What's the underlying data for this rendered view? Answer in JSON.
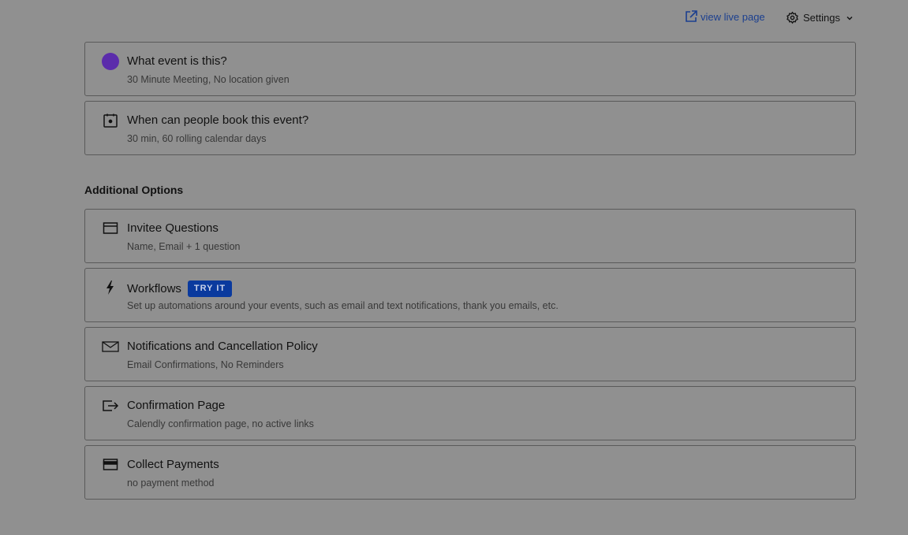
{
  "header": {
    "live_link_label": "view live page",
    "settings_label": "Settings"
  },
  "event_cards": [
    {
      "title": "What event is this?",
      "subtitle": "30 Minute Meeting, No location given",
      "icon": "purple-dot-icon"
    },
    {
      "title": "When can people book this event?",
      "subtitle": "30 min, 60 rolling calendar days",
      "icon": "calendar-icon"
    }
  ],
  "additional_options": {
    "heading": "Additional Options",
    "items": [
      {
        "title": "Invitee Questions",
        "subtitle": "Name, Email + 1 question",
        "icon": "form-icon"
      },
      {
        "title": "Workflows",
        "badge": "TRY IT",
        "subtitle": "Set up automations around your events, such as email and text notifications, thank you emails, etc.",
        "icon": "lightning-icon"
      },
      {
        "title": "Notifications and Cancellation Policy",
        "subtitle": "Email Confirmations, No Reminders",
        "icon": "envelope-icon"
      },
      {
        "title": "Confirmation Page",
        "subtitle": "Calendly confirmation page, no active links",
        "icon": "redirect-icon"
      },
      {
        "title": "Collect Payments",
        "subtitle": "no payment method",
        "icon": "credit-card-icon"
      }
    ]
  },
  "colors": {
    "background": "#909090",
    "link": "#1b3f8f",
    "badge": "#0a3a9e",
    "event_color": "#5b2cab"
  }
}
